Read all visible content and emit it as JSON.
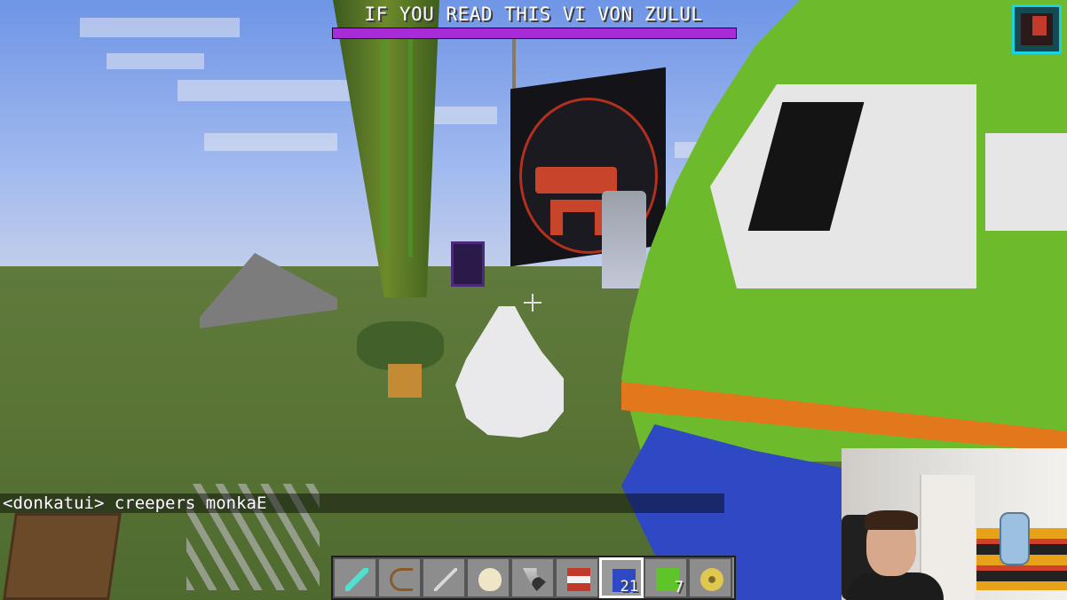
{
  "hud": {
    "bossbar": {
      "title": "IF YOU READ THIS VI VON ZULUL",
      "fill_fraction": 1.0,
      "color": "#a82bd8"
    },
    "chat": {
      "message": "<donkatui> creepers monkaE"
    },
    "hotbar": {
      "selected_index": 6,
      "slots": [
        {
          "item": "diamond-sword-icon",
          "count": ""
        },
        {
          "item": "bow-icon",
          "count": ""
        },
        {
          "item": "arrow-icon",
          "count": ""
        },
        {
          "item": "egg-icon",
          "count": ""
        },
        {
          "item": "flint-and-steel-icon",
          "count": ""
        },
        {
          "item": "tnt-icon",
          "count": ""
        },
        {
          "item": "blue-wool-icon",
          "count": "21"
        },
        {
          "item": "lime-wool-icon",
          "count": "7"
        },
        {
          "item": "spawn-egg-icon",
          "count": ""
        }
      ]
    }
  },
  "overlay": {
    "top_right_icon": "stream-logo-icon"
  },
  "webcam": {
    "present": true
  }
}
